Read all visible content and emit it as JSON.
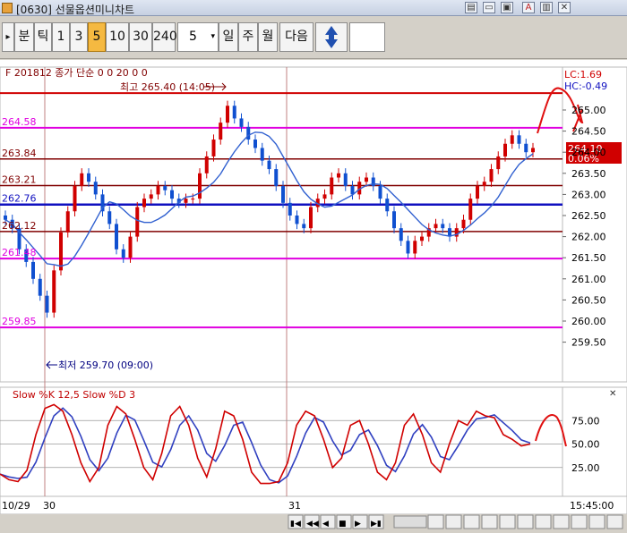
{
  "window": {
    "title": "[0630] 선물옵션미니차트",
    "controls": [
      "▤",
      "▭",
      "▣",
      "A",
      "▥",
      "✕"
    ]
  },
  "toolbar": {
    "arrow": "▸",
    "buttons": [
      "분",
      "틱",
      "1",
      "3",
      "5",
      "10",
      "30",
      "240"
    ],
    "active": "5",
    "interval_value": "5",
    "period_buttons": [
      "일",
      "주",
      "월"
    ],
    "next_label": "다음"
  },
  "chart": {
    "header_text": "F 201812 종가 단순 0  0  20  0  0",
    "lc_label": "LC:1.69",
    "hc_label": "HC:-0.49",
    "high_note": "최고 265.40 (14:05)",
    "low_note": "최저 259.70 (09:00)",
    "current_price": "264.10",
    "current_change": "0.06%",
    "price_ticks": [
      "265.00",
      "264.50",
      "264.00",
      "263.50",
      "263.00",
      "262.50",
      "262.00",
      "261.50",
      "261.00",
      "260.50",
      "260.00",
      "259.50"
    ],
    "level_labels": [
      "264.58",
      "263.84",
      "263.21",
      "262.76",
      "262.12",
      "261.48",
      "259.85"
    ],
    "stoch_title": "Slow %K 12,5  Slow %D 3",
    "stoch_ticks": [
      "75.00",
      "50.00",
      "25.00"
    ],
    "x_labels": [
      "10/29",
      "30",
      "31"
    ],
    "time_label": "15:45:00",
    "colors": {
      "resistance": "#d00000",
      "magenta": "#e000e0",
      "dark_red": "#800000",
      "blue_line": "#1010c0",
      "ma": "#3060d0",
      "up_candle": "#d00000",
      "down_candle": "#1050d0",
      "stoch_k": "#d00000",
      "stoch_d": "#3040c0"
    }
  }
}
